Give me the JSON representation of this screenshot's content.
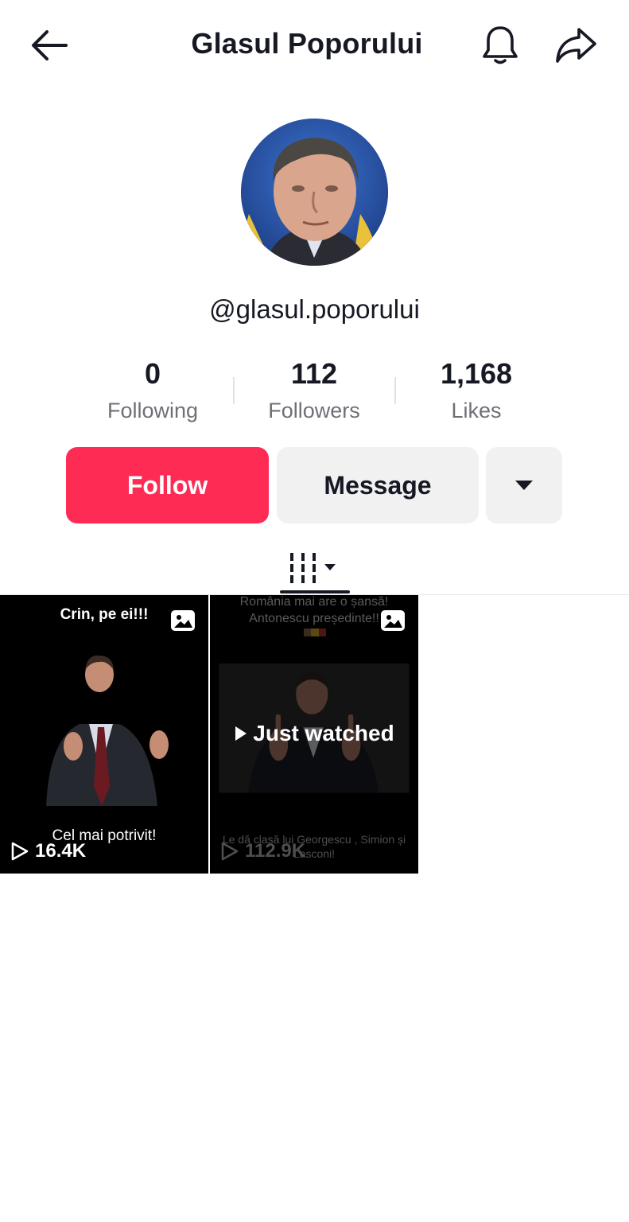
{
  "header": {
    "title": "Glasul Poporului",
    "back_icon": "arrow-left-icon",
    "bell_icon": "bell-icon",
    "share_icon": "share-arrow-icon"
  },
  "profile": {
    "username": "@glasul.poporului",
    "stats": [
      {
        "value": "0",
        "label": "Following"
      },
      {
        "value": "112",
        "label": "Followers"
      },
      {
        "value": "1,168",
        "label": "Likes"
      }
    ]
  },
  "actions": {
    "follow_label": "Follow",
    "message_label": "Message",
    "more_icon": "caret-down-icon"
  },
  "tabs": {
    "videos_icon": "grid-columns-icon"
  },
  "videos": [
    {
      "top_caption": "Crin, pe ei!!!",
      "bottom_caption": "Cel mai potrivit!",
      "plays": "16.4K"
    },
    {
      "top_caption": "România mai are o șansă! Antonescu președinte!!",
      "bottom_caption": "Le dă clasă lui Georgescu , Simion și Lasconi!",
      "plays": "112.9K",
      "overlay": "Just watched"
    }
  ],
  "colors": {
    "follow": "#fe2c55",
    "secondary_button": "#f1f1f2",
    "text": "#161823",
    "muted": "#6f7077"
  }
}
